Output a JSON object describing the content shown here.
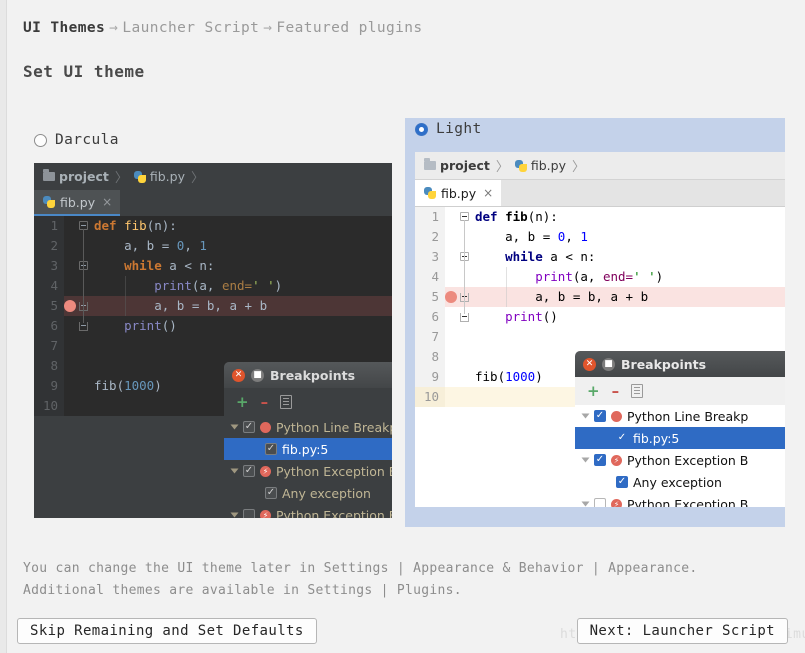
{
  "header": {
    "breadcrumb": [
      {
        "label": "UI Themes",
        "current": true
      },
      {
        "label": "Launcher Script",
        "current": false
      },
      {
        "label": "Featured plugins",
        "current": false
      }
    ],
    "arrow": "→",
    "title": "Set UI theme"
  },
  "themes": [
    {
      "id": "darcula",
      "label": "Darcula",
      "selected": false,
      "preview": {
        "breadcrumbs": [
          {
            "icon": "folder-icon",
            "label": "project",
            "bold": true
          },
          {
            "icon": "python-file-icon",
            "label": "fib.py",
            "bold": false
          }
        ],
        "crumb_separator": "〉",
        "tab": {
          "icon": "python-file-icon",
          "label": "fib.py",
          "close": "×"
        },
        "gutter_lines": [
          "1",
          "2",
          "3",
          "4",
          "5",
          "6",
          "7",
          "8",
          "9",
          "10"
        ],
        "breakpoint_line": 5,
        "caret_line": null,
        "code": [
          [
            {
              "t": "def ",
              "c": "kw"
            },
            {
              "t": "fib",
              "c": "fn"
            },
            {
              "t": "(n):",
              "c": "txt"
            }
          ],
          [
            {
              "t": "    a, b = ",
              "c": "txt"
            },
            {
              "t": "0",
              "c": "num"
            },
            {
              "t": ", ",
              "c": "txt"
            },
            {
              "t": "1",
              "c": "num"
            }
          ],
          [
            {
              "t": "    ",
              "c": "txt"
            },
            {
              "t": "while",
              "c": "kw"
            },
            {
              "t": " a < n:",
              "c": "txt"
            }
          ],
          [
            {
              "t": "        ",
              "c": "txt"
            },
            {
              "t": "print",
              "c": "call"
            },
            {
              "t": "(a, ",
              "c": "txt"
            },
            {
              "t": "end=",
              "c": "kwarg"
            },
            {
              "t": "' '",
              "c": "str"
            },
            {
              "t": ")",
              "c": "txt"
            }
          ],
          [
            {
              "t": "        a, b = b, a + b",
              "c": "txt"
            }
          ],
          [
            {
              "t": "    ",
              "c": "txt"
            },
            {
              "t": "print",
              "c": "call"
            },
            {
              "t": "()",
              "c": "txt"
            }
          ],
          [],
          [],
          [
            {
              "t": "fib(",
              "c": "txt"
            },
            {
              "t": "1000",
              "c": "num"
            },
            {
              "t": ")",
              "c": "txt"
            }
          ],
          []
        ]
      },
      "dialog": {
        "title": "Breakpoints",
        "toolbar": [
          {
            "icon": "add-icon",
            "glyph": "+"
          },
          {
            "icon": "remove-icon",
            "glyph": "–"
          },
          {
            "icon": "copy-document-icon",
            "glyph": ""
          }
        ],
        "rows": [
          {
            "label": "Python Line Breakp",
            "expander": true,
            "checked": true,
            "icon": "breakpoint-dot-icon",
            "indent": 0,
            "selected": false
          },
          {
            "label": "fib.py:5",
            "expander": false,
            "checked": true,
            "icon": "",
            "indent": 1,
            "selected": true
          },
          {
            "label": "Python Exception B",
            "expander": true,
            "checked": true,
            "icon": "exception-breakpoint-icon",
            "indent": 0,
            "selected": false
          },
          {
            "label": "Any exception",
            "expander": false,
            "checked": true,
            "icon": "",
            "indent": 1,
            "selected": false
          },
          {
            "label": "Python Exception B",
            "expander": true,
            "checked": false,
            "icon": "exception-breakpoint-icon",
            "indent": 0,
            "selected": false
          }
        ]
      }
    },
    {
      "id": "light",
      "label": "Light",
      "selected": true,
      "preview": {
        "breadcrumbs": [
          {
            "icon": "folder-icon",
            "label": "project",
            "bold": true
          },
          {
            "icon": "python-file-icon",
            "label": "fib.py",
            "bold": false
          }
        ],
        "crumb_separator": "〉",
        "tab": {
          "icon": "python-file-icon",
          "label": "fib.py",
          "close": "×"
        },
        "gutter_lines": [
          "1",
          "2",
          "3",
          "4",
          "5",
          "6",
          "7",
          "8",
          "9",
          "10"
        ],
        "breakpoint_line": 5,
        "caret_line": 10,
        "code": [
          [
            {
              "t": "def ",
              "c": "kw"
            },
            {
              "t": "fib",
              "c": "fn"
            },
            {
              "t": "(n):",
              "c": "txt"
            }
          ],
          [
            {
              "t": "    a, b = ",
              "c": "txt"
            },
            {
              "t": "0",
              "c": "num"
            },
            {
              "t": ", ",
              "c": "txt"
            },
            {
              "t": "1",
              "c": "num"
            }
          ],
          [
            {
              "t": "    ",
              "c": "txt"
            },
            {
              "t": "while",
              "c": "kw"
            },
            {
              "t": " a < n:",
              "c": "txt"
            }
          ],
          [
            {
              "t": "        ",
              "c": "txt"
            },
            {
              "t": "print",
              "c": "call"
            },
            {
              "t": "(a, ",
              "c": "txt"
            },
            {
              "t": "end=",
              "c": "kwarg"
            },
            {
              "t": "' '",
              "c": "str"
            },
            {
              "t": ")",
              "c": "txt"
            }
          ],
          [
            {
              "t": "        a, b = b, a + b",
              "c": "txt"
            }
          ],
          [
            {
              "t": "    ",
              "c": "txt"
            },
            {
              "t": "print",
              "c": "call"
            },
            {
              "t": "()",
              "c": "txt"
            }
          ],
          [],
          [],
          [
            {
              "t": "fib(",
              "c": "txt"
            },
            {
              "t": "1000",
              "c": "num"
            },
            {
              "t": ")",
              "c": "txt"
            }
          ],
          []
        ]
      },
      "dialog": {
        "title": "Breakpoints",
        "toolbar": [
          {
            "icon": "add-icon",
            "glyph": "+"
          },
          {
            "icon": "remove-icon",
            "glyph": "–"
          },
          {
            "icon": "copy-document-icon",
            "glyph": ""
          }
        ],
        "rows": [
          {
            "label": "Python Line Breakp",
            "expander": true,
            "checked": true,
            "icon": "breakpoint-dot-icon",
            "indent": 0,
            "selected": false
          },
          {
            "label": "fib.py:5",
            "expander": false,
            "checked": true,
            "icon": "",
            "indent": 1,
            "selected": true
          },
          {
            "label": "Python Exception B",
            "expander": true,
            "checked": true,
            "icon": "exception-breakpoint-icon",
            "indent": 0,
            "selected": false
          },
          {
            "label": "Any exception",
            "expander": false,
            "checked": true,
            "icon": "",
            "indent": 1,
            "selected": false
          },
          {
            "label": "Python Exception B",
            "expander": true,
            "checked": false,
            "icon": "exception-breakpoint-icon",
            "indent": 0,
            "selected": false
          }
        ]
      }
    }
  ],
  "footer": {
    "note_line1": "You can change the UI theme later in Settings | Appearance & Behavior | Appearance.",
    "note_line2": "Additional themes are available in Settings | Plugins.",
    "skip_button": "Skip Remaining and Set Defaults",
    "next_button": "Next: Launcher Script",
    "watermark": "https://blog.csdn.net/Xemdaimuan"
  },
  "colors": {
    "accent": "#2f6bc4",
    "selection_bg": "#c4d2ea",
    "breakpoint": "#e0685c",
    "dark_editor_bg": "#2b2b2b",
    "light_editor_bg": "#ffffff"
  }
}
